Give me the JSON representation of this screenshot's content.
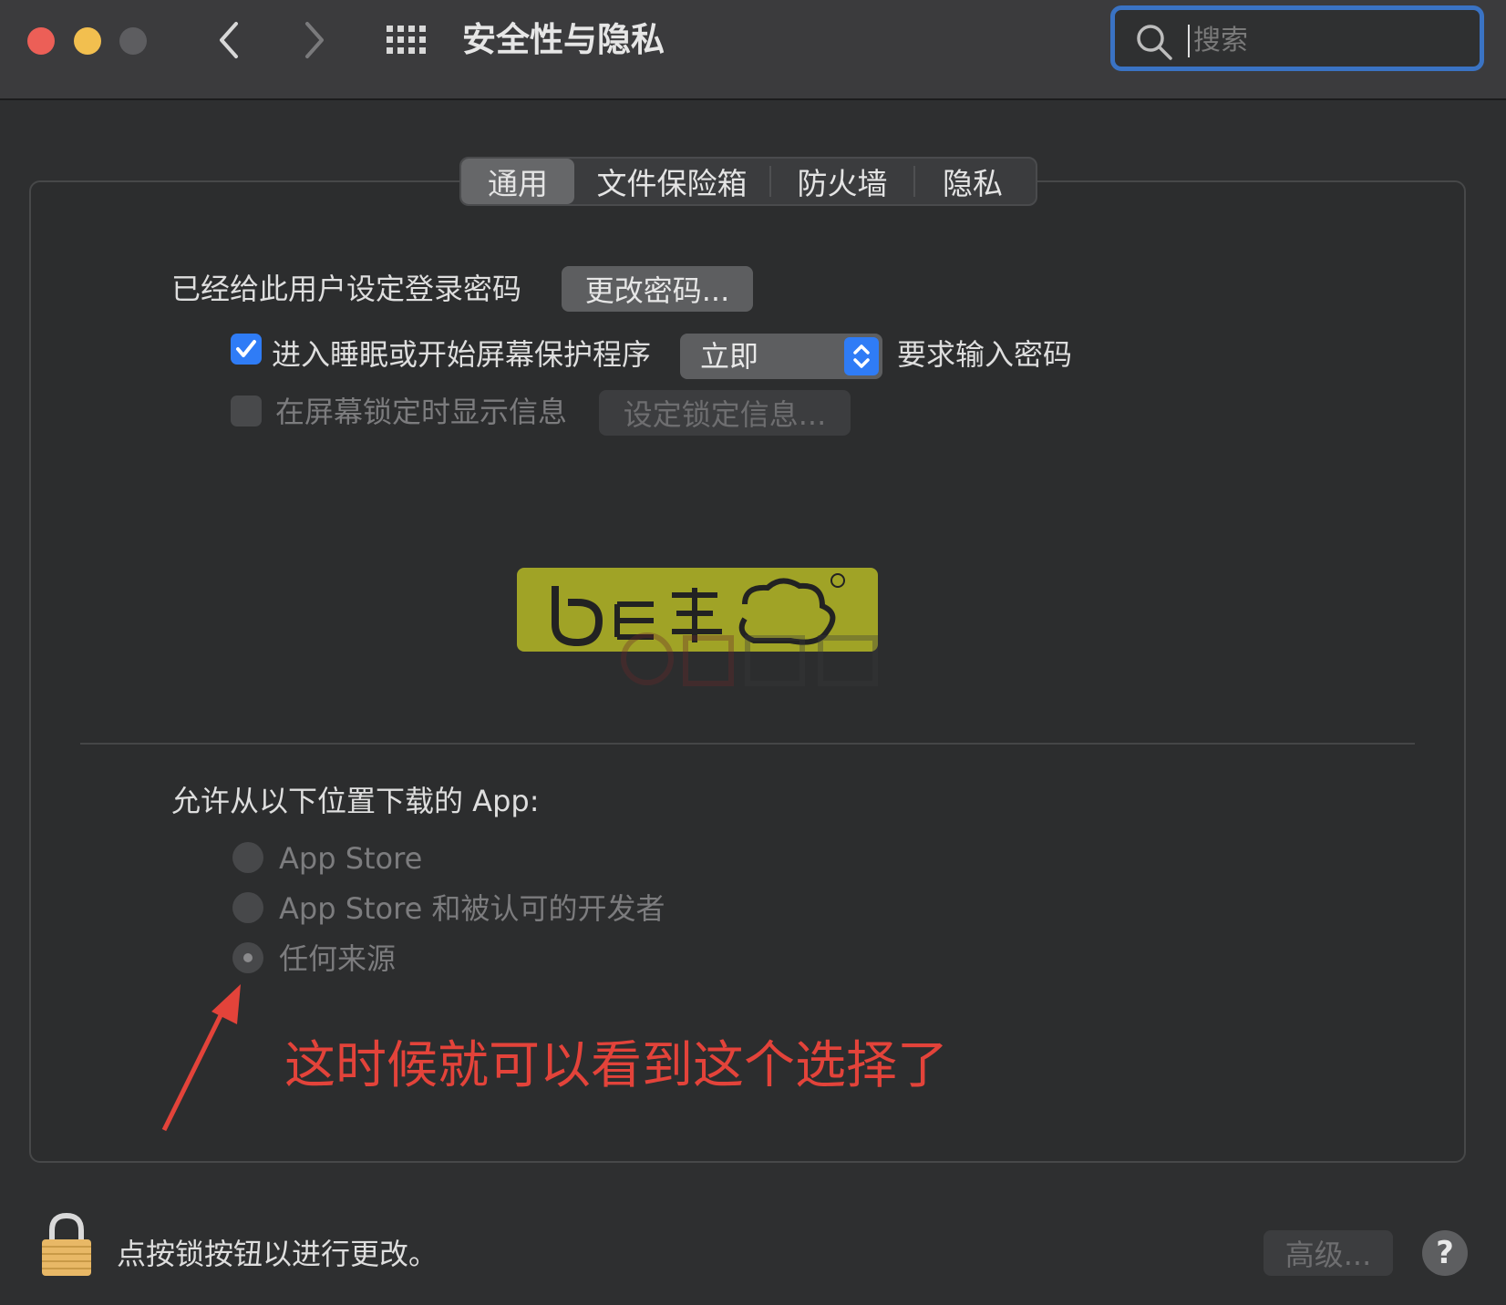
{
  "window": {
    "title": "安全性与隐私"
  },
  "search": {
    "placeholder": "搜索",
    "value": ""
  },
  "tabs": [
    {
      "label": "通用",
      "active": true
    },
    {
      "label": "文件保险箱",
      "active": false
    },
    {
      "label": "防火墙",
      "active": false
    },
    {
      "label": "隐私",
      "active": false
    }
  ],
  "general": {
    "password_set_label": "已经给此用户设定登录密码",
    "change_password_button": "更改密码...",
    "require_password": {
      "checked": true,
      "label": "进入睡眠或开始屏幕保护程序",
      "select_value": "立即",
      "suffix": "要求输入密码"
    },
    "show_message": {
      "checked": false,
      "label": "在屏幕锁定时显示信息",
      "button": "设定锁定信息..."
    }
  },
  "gatekeeper": {
    "heading": "允许从以下位置下载的 App:",
    "options": [
      {
        "label": "App Store",
        "selected": false
      },
      {
        "label": "App Store 和被认可的开发者",
        "selected": false
      },
      {
        "label": "任何来源",
        "selected": true
      }
    ]
  },
  "annotation": {
    "text": "这时候就可以看到这个选择了",
    "color": "#e3433a"
  },
  "footer": {
    "lock_text": "点按锁按钮以进行更改。",
    "advanced_button": "高级...",
    "help_button": "?"
  },
  "colors": {
    "accent": "#2f7cf6",
    "search_focus": "#3a73c4",
    "close": "#ec5f57",
    "minimize": "#f2bf4f"
  }
}
